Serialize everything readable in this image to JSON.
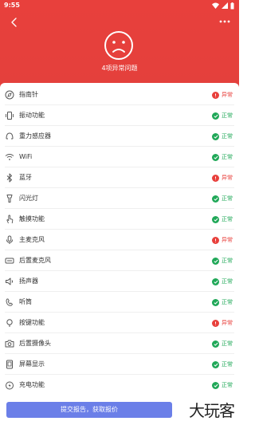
{
  "status_bar": {
    "time": "9:55"
  },
  "header": {
    "summary": "4项异常问题"
  },
  "items": [
    {
      "label": "指南针",
      "status": "异常",
      "ok": false,
      "icon": "compass-icon"
    },
    {
      "label": "振动功能",
      "status": "正常",
      "ok": true,
      "icon": "vibration-icon"
    },
    {
      "label": "重力感应器",
      "status": "正常",
      "ok": true,
      "icon": "gravity-sensor-icon"
    },
    {
      "label": "WiFi",
      "status": "正常",
      "ok": true,
      "icon": "wifi-icon"
    },
    {
      "label": "蓝牙",
      "status": "异常",
      "ok": false,
      "icon": "bluetooth-icon"
    },
    {
      "label": "闪光灯",
      "status": "正常",
      "ok": true,
      "icon": "flashlight-icon"
    },
    {
      "label": "触摸功能",
      "status": "正常",
      "ok": true,
      "icon": "touch-icon"
    },
    {
      "label": "主麦克风",
      "status": "异常",
      "ok": false,
      "icon": "microphone-icon"
    },
    {
      "label": "后置麦克风",
      "status": "正常",
      "ok": true,
      "icon": "rear-microphone-icon"
    },
    {
      "label": "扬声器",
      "status": "正常",
      "ok": true,
      "icon": "speaker-icon"
    },
    {
      "label": "听筒",
      "status": "正常",
      "ok": true,
      "icon": "earpiece-icon"
    },
    {
      "label": "按键功能",
      "status": "异常",
      "ok": false,
      "icon": "keys-icon"
    },
    {
      "label": "后置摄像头",
      "status": "正常",
      "ok": true,
      "icon": "camera-icon"
    },
    {
      "label": "屏幕显示",
      "status": "正常",
      "ok": true,
      "icon": "screen-icon"
    },
    {
      "label": "充电功能",
      "status": "正常",
      "ok": true,
      "icon": "charging-icon"
    }
  ],
  "footer": {
    "submit_label": "提交报告，获取报价"
  },
  "watermark": {
    "text": "大玩客"
  },
  "colors": {
    "header": "#e8403c",
    "ok": "#20a858",
    "bad": "#e8403c",
    "button": "#6b7fe8"
  }
}
